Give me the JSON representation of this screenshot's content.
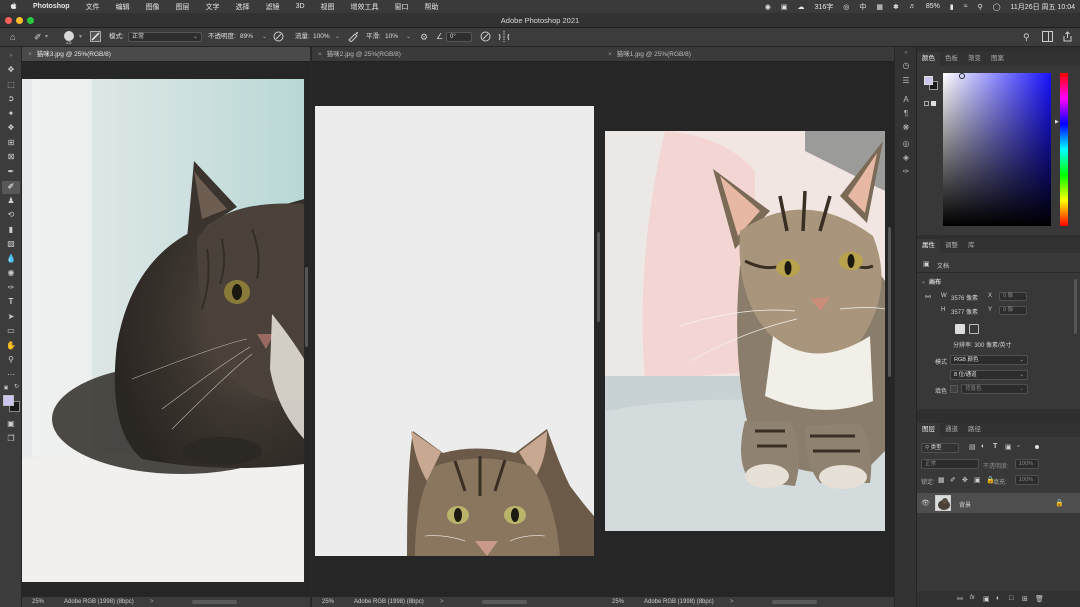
{
  "menubar": {
    "apple": "",
    "app_name": "Photoshop",
    "menus": [
      "文件",
      "编辑",
      "图像",
      "图层",
      "文字",
      "选择",
      "滤镜",
      "3D",
      "视图",
      "增效工具",
      "窗口",
      "帮助"
    ],
    "word_count": "316字",
    "input_method": "中",
    "battery": "85%",
    "datetime": "11月26日 周五 10:04"
  },
  "window": {
    "title": "Adobe Photoshop 2021"
  },
  "options": {
    "brush_size": "25",
    "mode_label": "模式:",
    "mode_value": "正常",
    "opacity_label": "不透明度:",
    "opacity_value": "89%",
    "flow_label": "流量:",
    "flow_value": "100%",
    "smooth_label": "平滑:",
    "smooth_value": "10%",
    "angle_value": "0°"
  },
  "documents": [
    {
      "tab": "猫咪3.jpg @ 25%(RGB/8)",
      "zoom": "25%",
      "profile": "Adobe RGB (1998) (8bpc)",
      "arrow": ">"
    },
    {
      "tab": "猫咪2.jpg @ 25%(RGB/8)",
      "zoom": "25%",
      "profile": "Adobe RGB (1998) (8bpc)",
      "arrow": ">"
    },
    {
      "tab": "猫咪1.jpg @ 25%(RGB/8)",
      "zoom": "25%",
      "profile": "Adobe RGB (1998) (8bpc)",
      "arrow": ">"
    }
  ],
  "color_panel": {
    "tabs": [
      "颜色",
      "色板",
      "渐变",
      "图案"
    ],
    "foreground": "#c9c6ef",
    "background": "#1a1a1a"
  },
  "properties_panel": {
    "tabs": [
      "属性",
      "调整",
      "库"
    ],
    "doc_label": "文档",
    "section": "画布",
    "w_label": "W",
    "w_value": "3576 像素",
    "h_label": "H",
    "h_value": "3577 像素",
    "x_label": "X",
    "x_value": "0 像",
    "y_label": "Y",
    "y_value": "0 像",
    "resolution": "分辨率: 300 像素/英寸",
    "mode_label": "模式",
    "mode_value": "RGB 颜色",
    "depth_value": "8 位/通道",
    "fill_label": "填色",
    "fill_value": "背景色"
  },
  "layers_panel": {
    "tabs": [
      "图层",
      "通道",
      "路径"
    ],
    "kind_label": "类型",
    "blend_mode": "正常",
    "opacity_label": "不透明度:",
    "opacity_value": "100%",
    "lock_label": "锁定:",
    "fill_label": "填充:",
    "fill_value": "100%",
    "layer_name": "背景"
  }
}
